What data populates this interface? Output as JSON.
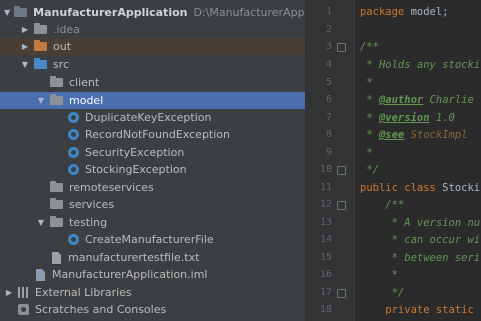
{
  "project_tree": {
    "root": {
      "name": "ManufacturerApplication",
      "path": "D:\\ManufacturerApplication"
    },
    "idea": "idea",
    "out": "out",
    "src": "src",
    "client": "client",
    "model": "model",
    "model_files": [
      "DuplicateKeyException",
      "RecordNotFoundException",
      "SecurityException",
      "StockingException"
    ],
    "remoteservices": "remoteservices",
    "services": "services",
    "testing": "testing",
    "testing_file": "CreateManufacturerFile",
    "txt_file": "manufacturertestfile.txt",
    "iml_file": "ManufacturerApplication.iml",
    "external_libraries": "External Libraries",
    "scratches": "Scratches and Consoles"
  },
  "editor": {
    "line_numbers": [
      "1",
      "2",
      "3",
      "4",
      "5",
      "6",
      "7",
      "8",
      "9",
      "10",
      "11",
      "12",
      "13",
      "14",
      "15",
      "16",
      "17",
      "18"
    ],
    "l1_kw": "package",
    "l1_rest": " model;",
    "l3": "/**",
    "l4": " * Holds any stocki",
    "l5": " *",
    "l6_pre": " * ",
    "l6_tag": "@author",
    "l6_val": " Charlie",
    "l7_pre": " * ",
    "l7_tag": "@version",
    "l7_val": " 1.0",
    "l8_pre": " * ",
    "l8_tag": "@see",
    "l8_val": " StockImpl",
    "l9": " *",
    "l10": " */",
    "l11_kw": "public class",
    "l11_rest": " Stockin",
    "l12": "    /**",
    "l13": "     * A version nu",
    "l14": "     * can occur wi",
    "l15": "     * between seri",
    "l16": "     *",
    "l17": "     */",
    "l18_kw": "    private static"
  },
  "colors": {
    "selection": "#4b6eaf",
    "excluded_folder_bg": "#4a3f36",
    "keyword": "#cc7832",
    "comment": "#629755"
  }
}
